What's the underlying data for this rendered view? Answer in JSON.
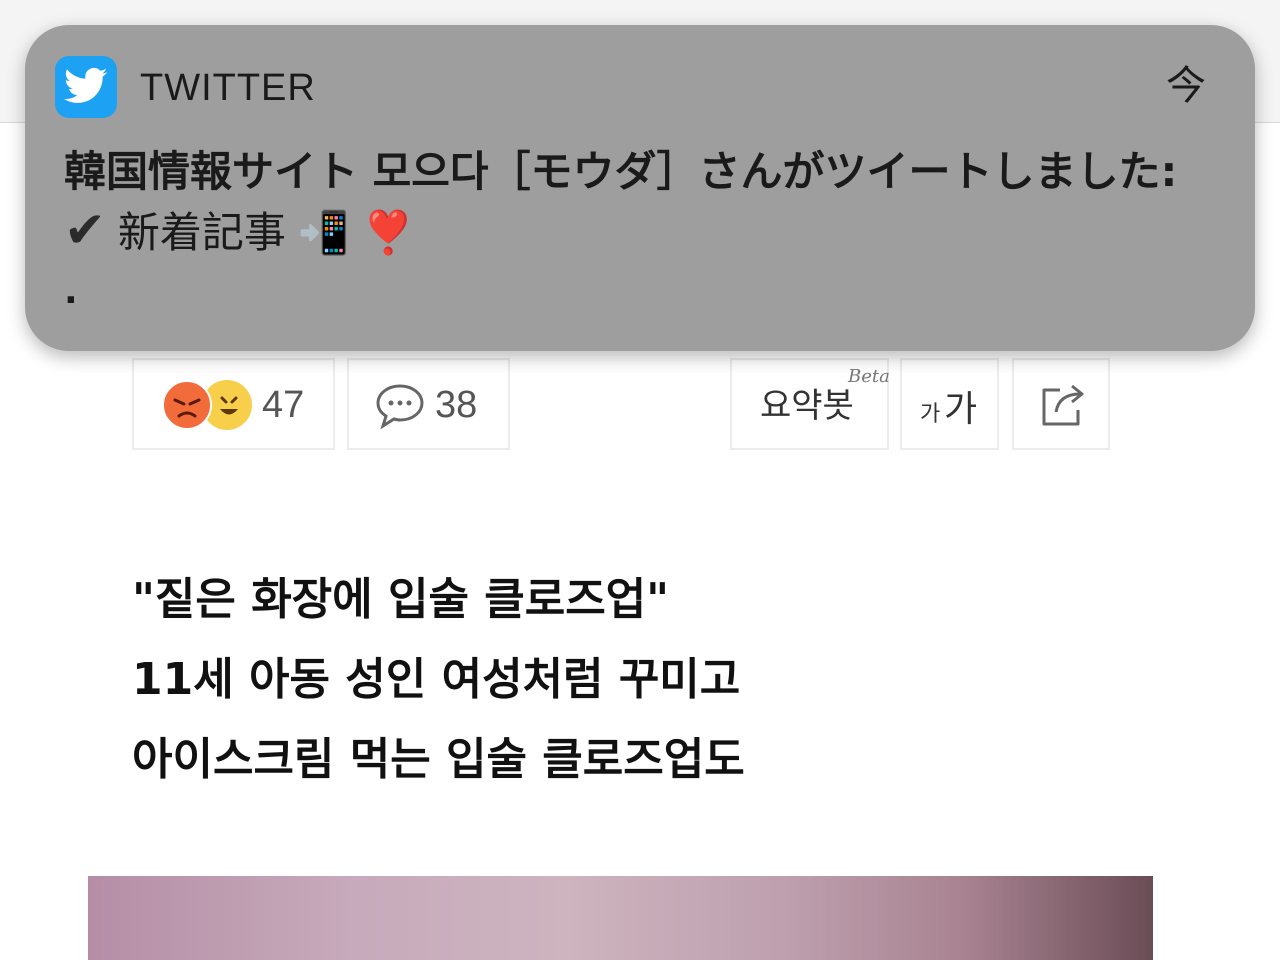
{
  "notification": {
    "app_name": "TWITTER",
    "time_glyph": "今",
    "line1": "韓国情報サイト 모으다［モウダ］さんがツイートしました:",
    "line2_check": "✔",
    "line2_text": "新着記事",
    "line2_phone": "📲",
    "line2_heart": "❣️",
    "line3": ".",
    "icon": "twitter-bird-icon",
    "icon_color": "#1da1f2"
  },
  "action_bar": {
    "reactions_count": "47",
    "comments_count": "38",
    "summary_label": "요약봇",
    "beta_label": "Beta",
    "font_small": "가",
    "font_big": "가",
    "share_icon": "share-icon"
  },
  "article": {
    "headline": [
      "\"짙은 화장에 입술 클로즈업\"",
      "11세 아동 성인 여성처럼 꾸미고",
      "아이스크림 먹는 입술 클로즈업도"
    ]
  }
}
